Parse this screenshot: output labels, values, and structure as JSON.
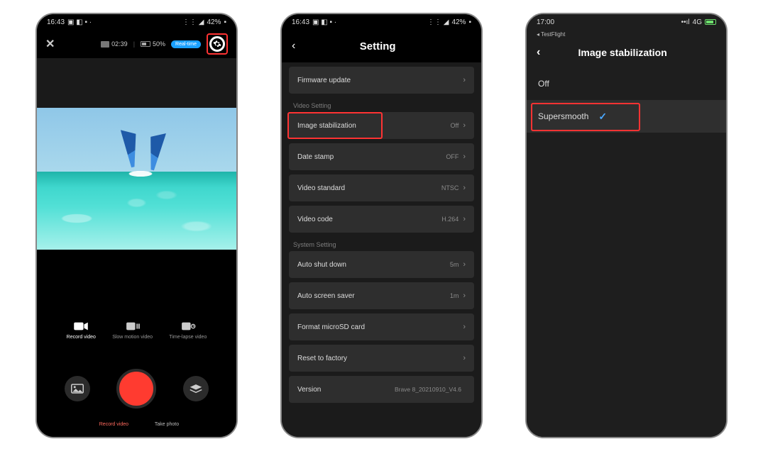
{
  "phone1": {
    "status": {
      "time": "16:43",
      "battery": "42%"
    },
    "topbar": {
      "sd_time": "02:39",
      "batt_pct": "50%",
      "pill_label": "Real‑time"
    },
    "modes": {
      "record_video": "Record video",
      "slow_motion": "Slow motion video",
      "time_lapse": "Time-lapse video"
    },
    "controls": {
      "record_label": "Record video",
      "take_photo_label": "Take photo"
    }
  },
  "phone2": {
    "status": {
      "time": "16:43",
      "battery": "42%"
    },
    "header_title": "Setting",
    "rows": {
      "firmware": "Firmware update",
      "section_video": "Video Setting",
      "image_stab": {
        "label": "Image stabilization",
        "value": "Off"
      },
      "date_stamp": {
        "label": "Date stamp",
        "value": "OFF"
      },
      "video_standard": {
        "label": "Video standard",
        "value": "NTSC"
      },
      "video_code": {
        "label": "Video code",
        "value": "H.264"
      },
      "section_system": "System Setting",
      "auto_shut": {
        "label": "Auto shut down",
        "value": "5m"
      },
      "auto_saver": {
        "label": "Auto screen saver",
        "value": "1m"
      },
      "format": "Format microSD card",
      "reset": "Reset to factory",
      "version": {
        "label": "Version",
        "value": "Brave 8_20210910_V4.6"
      }
    }
  },
  "phone3": {
    "status": {
      "time": "17:00",
      "signal": "4G"
    },
    "testflight": "◂ TestFlight",
    "header_title": "Image stabilization",
    "options": {
      "off": "Off",
      "supersmooth": "Supersmooth"
    }
  }
}
